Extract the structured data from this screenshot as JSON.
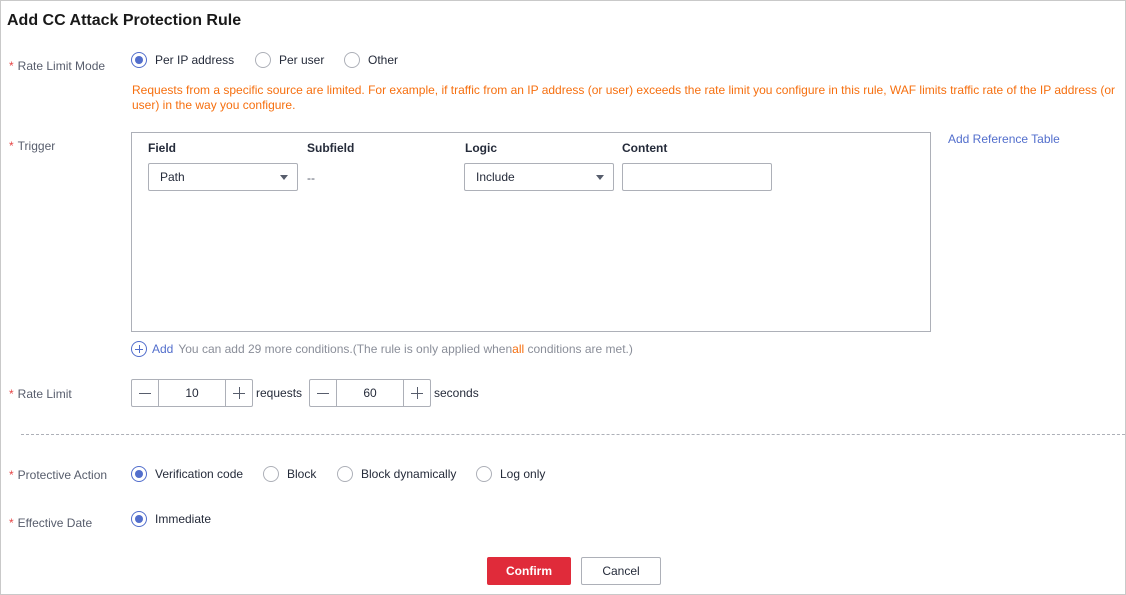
{
  "dialog": {
    "title": "Add CC Attack Protection Rule"
  },
  "rate_limit_mode": {
    "label": "Rate Limit Mode",
    "options": [
      "Per IP address",
      "Per user",
      "Other"
    ],
    "selected": "Per IP address",
    "hint": "Requests from a specific source are limited. For example, if traffic from an IP address (or user) exceeds the rate limit you configure in this rule, WAF limits traffic rate of the IP address (or user) in the way you configure."
  },
  "trigger": {
    "label": "Trigger",
    "columns": [
      "Field",
      "Subfield",
      "Logic",
      "Content"
    ],
    "row": {
      "field": "Path",
      "subfield": "--",
      "logic": "Include",
      "content": ""
    },
    "add_reference_table": "Add Reference Table",
    "add_label": "Add",
    "add_note_prefix": "You can add 29 more conditions.(The rule is only applied when ",
    "add_note_highlight": "all",
    "add_note_suffix": " conditions are met.)"
  },
  "rate_limit": {
    "label": "Rate Limit",
    "requests_value": "10",
    "requests_unit": "requests",
    "seconds_value": "60",
    "seconds_unit": "seconds"
  },
  "protective_action": {
    "label": "Protective Action",
    "options": [
      "Verification code",
      "Block",
      "Block dynamically",
      "Log only"
    ],
    "selected": "Verification code"
  },
  "effective_date": {
    "label": "Effective Date",
    "options": [
      "Immediate"
    ],
    "selected": "Immediate"
  },
  "footer": {
    "confirm": "Confirm",
    "cancel": "Cancel"
  },
  "colors": {
    "accent": "#526ecc",
    "required_star": "#e54545",
    "hint_orange": "#f66f0f",
    "confirm_red": "#e02b3a"
  }
}
